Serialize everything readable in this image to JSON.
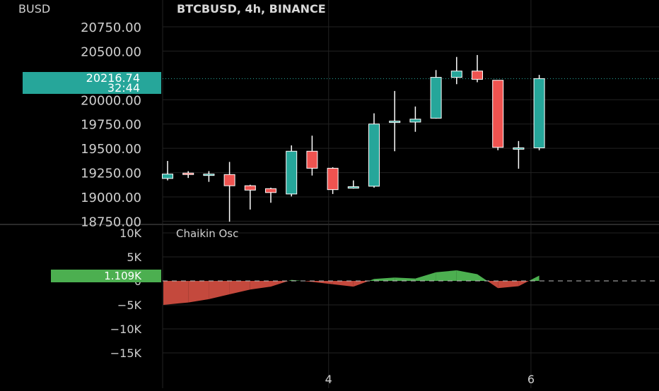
{
  "header": {
    "currency": "BUSD",
    "symbol_line": "BTCBUSD, 4h, BINANCE"
  },
  "price_label": {
    "price": "20216.74",
    "countdown": "32:44"
  },
  "indicator": {
    "name": "Chaikin Osc",
    "current_label": "1.109K"
  },
  "colors": {
    "background": "#000000",
    "grid": "#222222",
    "axis_text": "#cfcfcf",
    "up": "#26a69a",
    "down": "#ef5350",
    "wick": "#ffffff",
    "price_badge": "#26a69a",
    "osc_badge": "#4caf50",
    "osc_positive": "#4caf50",
    "osc_negative": "#c4493d",
    "divider": "#2a2a2a"
  },
  "chart_data": [
    {
      "type": "candlestick",
      "title": "BTCBUSD, 4h, BINANCE",
      "ylabel": "BUSD",
      "ylim": [
        18750,
        20880
      ],
      "y_ticks": [
        "20750.00",
        "20500.00",
        "20000.00",
        "19750.00",
        "19500.00",
        "19250.00",
        "19000.00",
        "18750.00"
      ],
      "y_tick_values": [
        20750,
        20500,
        20000,
        19750,
        19500,
        19250,
        19000,
        18750
      ],
      "x_ticks": [
        "4",
        "6"
      ],
      "x_tick_positions": [
        7.8,
        17.6
      ],
      "last_price": 20216.74,
      "candles": [
        {
          "o": 19190,
          "h": 19370,
          "l": 19170,
          "c": 19235
        },
        {
          "o": 19245,
          "h": 19265,
          "l": 19195,
          "c": 19230
        },
        {
          "o": 19225,
          "h": 19265,
          "l": 19155,
          "c": 19235
        },
        {
          "o": 19230,
          "h": 19360,
          "l": 18745,
          "c": 19115
        },
        {
          "o": 19115,
          "h": 19125,
          "l": 18870,
          "c": 19070
        },
        {
          "o": 19085,
          "h": 19095,
          "l": 18940,
          "c": 19045
        },
        {
          "o": 19030,
          "h": 19530,
          "l": 19005,
          "c": 19470
        },
        {
          "o": 19470,
          "h": 19630,
          "l": 19220,
          "c": 19295
        },
        {
          "o": 19295,
          "h": 19305,
          "l": 19030,
          "c": 19075
        },
        {
          "o": 19090,
          "h": 19170,
          "l": 19085,
          "c": 19105
        },
        {
          "o": 19110,
          "h": 19860,
          "l": 19095,
          "c": 19750
        },
        {
          "o": 19780,
          "h": 20090,
          "l": 19470,
          "c": 19780
        },
        {
          "o": 19770,
          "h": 19930,
          "l": 19670,
          "c": 19800
        },
        {
          "o": 19810,
          "h": 20305,
          "l": 19805,
          "c": 20230
        },
        {
          "o": 20230,
          "h": 20440,
          "l": 20160,
          "c": 20295
        },
        {
          "o": 20295,
          "h": 20460,
          "l": 20180,
          "c": 20210
        },
        {
          "o": 20200,
          "h": 20200,
          "l": 19480,
          "c": 19510
        },
        {
          "o": 19505,
          "h": 19575,
          "l": 19290,
          "c": 19505
        },
        {
          "o": 19505,
          "h": 20255,
          "l": 19480,
          "c": 20216.74
        }
      ]
    },
    {
      "type": "area",
      "title": "Chaikin Osc",
      "ylim": [
        -19000,
        11000
      ],
      "y_ticks": [
        "10K",
        "5K",
        "0",
        "−5K",
        "−10K",
        "−15K"
      ],
      "y_tick_values": [
        10000,
        5000,
        0,
        -5000,
        -10000,
        -15000
      ],
      "zero_line": 0,
      "current": 1109,
      "x": [
        0,
        1,
        2,
        3,
        4,
        5,
        6,
        7,
        8,
        9,
        10,
        11,
        12,
        13,
        14,
        15,
        16,
        17,
        18
      ],
      "values": [
        -5000,
        -4500,
        -3800,
        -2800,
        -1800,
        -1200,
        200,
        -200,
        -700,
        -1200,
        400,
        700,
        500,
        1800,
        2200,
        1400,
        -1500,
        -1100,
        1109
      ]
    }
  ]
}
